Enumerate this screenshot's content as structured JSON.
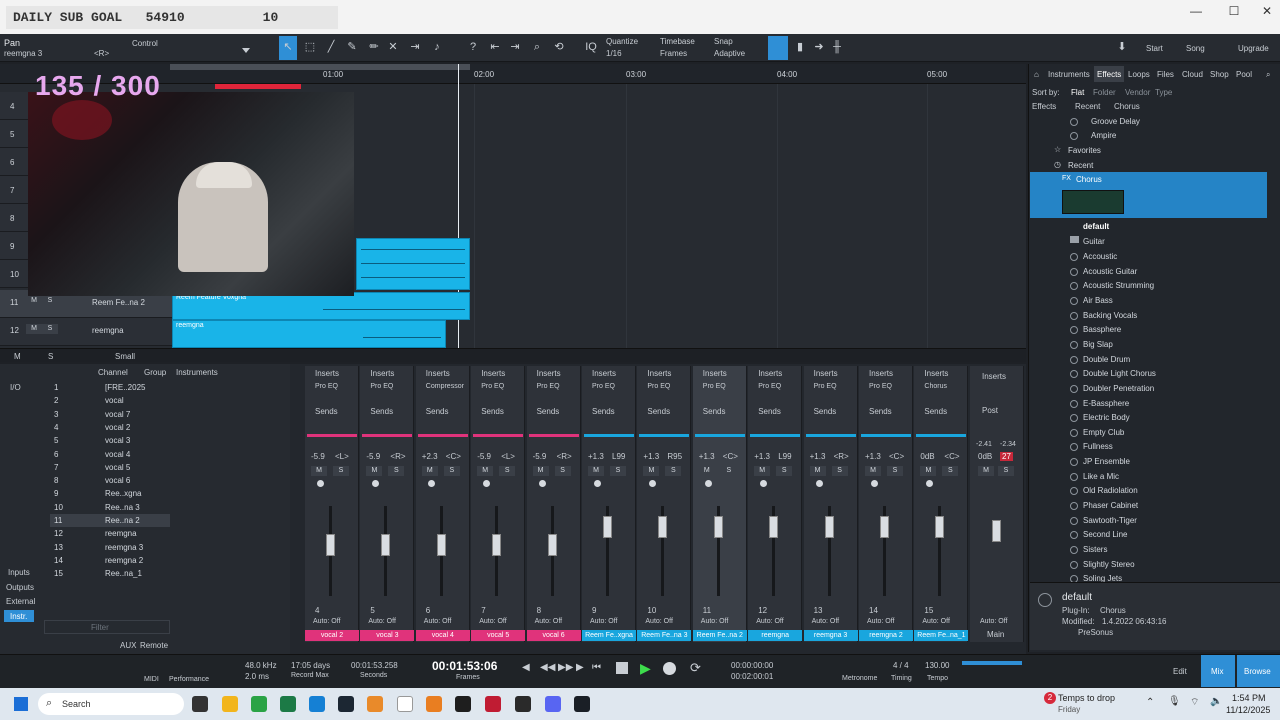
{
  "overlay": {
    "sub_goal_label": "DAILY SUB GOAL",
    "sub_goal_value": "54910",
    "sub_goal_extra": "10",
    "counter": "135 / 300"
  },
  "window": {
    "minimize": "—",
    "maximize": "☐",
    "close": "✕"
  },
  "toolbar": {
    "pan_label": "Pan",
    "control_label": "Control",
    "track_name": "reemgna 3",
    "pan_value": "<R>",
    "quantize_label": "Quantize",
    "quantize_value": "1/16",
    "timebase_label": "Timebase",
    "timebase_value": "Frames",
    "snap_label": "Snap",
    "snap_value": "Adaptive",
    "start_label": "Start",
    "song_label": "Song",
    "upgrade_label": "Upgrade"
  },
  "ruler": {
    "ticks": [
      "01:00",
      "02:00",
      "03:00",
      "04:00",
      "05:00"
    ]
  },
  "tracks": [
    {
      "num": "4"
    },
    {
      "num": "5"
    },
    {
      "num": "6"
    },
    {
      "num": "7"
    },
    {
      "num": "8"
    },
    {
      "num": "9"
    },
    {
      "num": "10"
    },
    {
      "num": "11",
      "name": "Reem Fe..na 2",
      "m": "M",
      "s": "S"
    },
    {
      "num": "12",
      "name": "reemgna",
      "m": "M",
      "s": "S"
    }
  ],
  "clips": {
    "clip1_label": "Reem Feature Voxgna",
    "clip2_label": "reemgna"
  },
  "arrange_footer": {
    "m": "M",
    "s": "S",
    "size": "Small"
  },
  "browser": {
    "tabs": [
      "Instruments",
      "Effects",
      "Loops",
      "Files",
      "Cloud",
      "Shop",
      "Pool"
    ],
    "sort_label": "Sort by:",
    "sort_options": [
      "Flat",
      "Folder",
      "Vendor",
      "Type"
    ],
    "breadcrumb": [
      "Effects",
      "Recent",
      "Chorus"
    ],
    "top_items": [
      "Groove Delay",
      "Ampire"
    ],
    "favorites": "Favorites",
    "recent": "Recent",
    "selected": "Chorus",
    "preset_default": "default",
    "guitar_folder": "Guitar",
    "presets": [
      "Accoustic",
      "Acoustic Guitar",
      "Acoustic Strumming",
      "Air Bass",
      "Backing Vocals",
      "Bassphere",
      "Big Slap",
      "Double Drum",
      "Double Light Chorus",
      "Doubler Penetration",
      "E-Bassphere",
      "Electric Body",
      "Empty Club",
      "Fullness",
      "JP Ensemble",
      "Like a Mic",
      "Old Radiolation",
      "Phaser Cabinet",
      "Sawtooth-Tiger",
      "Second Line",
      "Sisters",
      "Slightly Stereo",
      "Soling Jets"
    ],
    "info": {
      "name": "default",
      "plugin_label": "Plug-In:",
      "plugin": "Chorus",
      "modified_label": "Modified:",
      "modified": "1.4.2022 06:43:16",
      "vendor": "PreSonus"
    }
  },
  "mixer_left": {
    "header": [
      "Channel",
      "Group",
      "Instruments"
    ],
    "io": "I/O",
    "side_labels": [
      "Inputs",
      "Outputs",
      "External",
      "Instr."
    ],
    "filter_placeholder": "Filter",
    "remote": "Remote",
    "aux": "AUX",
    "channels": [
      {
        "n": "1",
        "name": "[FRE..2025"
      },
      {
        "n": "2",
        "name": "vocal"
      },
      {
        "n": "3",
        "name": "vocal 7"
      },
      {
        "n": "4",
        "name": "vocal 2"
      },
      {
        "n": "5",
        "name": "vocal 3"
      },
      {
        "n": "6",
        "name": "vocal 4"
      },
      {
        "n": "7",
        "name": "vocal 5"
      },
      {
        "n": "8",
        "name": "vocal 6"
      },
      {
        "n": "9",
        "name": "Ree..xgna"
      },
      {
        "n": "10",
        "name": "Ree..na 3"
      },
      {
        "n": "11",
        "name": "Ree..na 2"
      },
      {
        "n": "12",
        "name": "reemgna"
      },
      {
        "n": "13",
        "name": "reemgna 3"
      },
      {
        "n": "14",
        "name": "reemgna 2"
      },
      {
        "n": "15",
        "name": "Ree..na_1"
      }
    ]
  },
  "strips": [
    {
      "num": "4",
      "name": "vocal 2",
      "insert": "Pro EQ",
      "vol": "-5.9",
      "pan": "<L>",
      "color": "#e0337b"
    },
    {
      "num": "5",
      "name": "vocal 3",
      "insert": "Pro EQ",
      "vol": "-5.9",
      "pan": "<R>",
      "color": "#e0337b"
    },
    {
      "num": "6",
      "name": "vocal 4",
      "insert": "Compressor",
      "vol": "+2.3",
      "pan": "<C>",
      "color": "#e0337b"
    },
    {
      "num": "7",
      "name": "vocal 5",
      "insert": "Pro EQ",
      "vol": "-5.9",
      "pan": "<L>",
      "color": "#e0337b"
    },
    {
      "num": "8",
      "name": "vocal 6",
      "insert": "Pro EQ",
      "vol": "-5.9",
      "pan": "<R>",
      "color": "#e0337b"
    },
    {
      "num": "9",
      "name": "Reem Fe..xgna",
      "insert": "Pro EQ",
      "vol": "+1.3",
      "pan": "L99",
      "color": "#19a6de"
    },
    {
      "num": "10",
      "name": "Reem Fe..na 3",
      "insert": "Pro EQ",
      "vol": "+1.3",
      "pan": "R95",
      "color": "#19a6de"
    },
    {
      "num": "11",
      "name": "Reem Fe..na 2",
      "insert": "Pro EQ",
      "vol": "+1.3",
      "pan": "<C>",
      "color": "#19a6de"
    },
    {
      "num": "12",
      "name": "reemgna",
      "insert": "Pro EQ",
      "vol": "+1.3",
      "pan": "L99",
      "color": "#19a6de"
    },
    {
      "num": "13",
      "name": "reemgna 3",
      "insert": "Pro EQ",
      "vol": "+1.3",
      "pan": "<R>",
      "color": "#19a6de"
    },
    {
      "num": "14",
      "name": "reemgna 2",
      "insert": "Pro EQ",
      "vol": "+1.3",
      "pan": "<C>",
      "color": "#19a6de"
    },
    {
      "num": "15",
      "name": "Reem Fe..na_1",
      "insert": "Chorus",
      "vol": "0dB",
      "pan": "<C>",
      "color": "#19a6de"
    }
  ],
  "strip_labels": {
    "inserts": "Inserts",
    "sends": "Sends",
    "auto": "Auto: Off",
    "m": "M",
    "s": "S"
  },
  "main": {
    "name": "Main",
    "vol": "0dB",
    "peak": "27",
    "post": "Post",
    "left_meter": "-2.41",
    "right_meter": "-2.34"
  },
  "transport": {
    "midi": "MIDI",
    "performance": "Performance",
    "rate": "48.0 kHz",
    "latency": "2.0 ms",
    "record_max_val": "17:05 days",
    "record_max": "Record Max",
    "seconds_val": "00:01:53.258",
    "seconds": "Seconds",
    "time": "00:01:53:06",
    "frames": "Frames",
    "loop_start": "00:00:00:00",
    "loop_end": "00:02:00:01",
    "metronome": "Metronome",
    "timing_val": "4 / 4",
    "timing": "Timing",
    "tempo_val": "130.00",
    "tempo": "Tempo",
    "edit": "Edit",
    "mix": "Mix",
    "browse": "Browse"
  },
  "taskbar": {
    "search": "Search",
    "weather": "Temps to drop",
    "weather_day": "Friday",
    "weather_badge": "2",
    "time": "1:54 PM",
    "date": "11/12/2025"
  }
}
